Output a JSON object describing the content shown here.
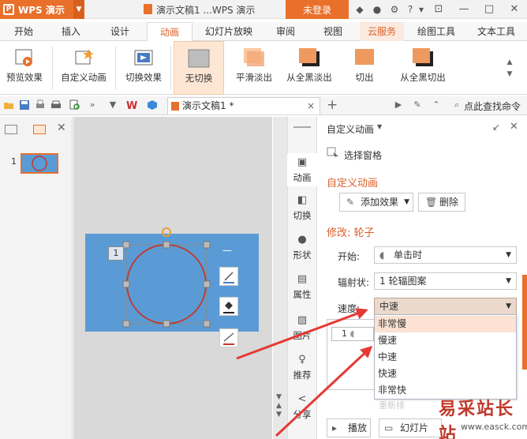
{
  "app": {
    "name": "WPS 演示",
    "logo_letter": "P"
  },
  "window": {
    "title": "演示文稿1 ...WPS 演示",
    "login": "未登录",
    "help": "?"
  },
  "tabs": [
    "开始",
    "插入",
    "设计",
    "动画",
    "幻灯片放映",
    "审阅",
    "视图",
    "云服务",
    "绘图工具",
    "文本工具"
  ],
  "active_tab": "动画",
  "ribbon": {
    "preview": "预览效果",
    "custom_anim": "自定义动画",
    "transition": "切换效果",
    "items": [
      "无切换",
      "平滑淡出",
      "从全黑淡出",
      "切出",
      "从全黑切出"
    ]
  },
  "qbar": {
    "doc_tab": "演示文稿1 *",
    "close": "×",
    "plus": "+",
    "search": "点此查找命令"
  },
  "slides": {
    "number": "1"
  },
  "canvas": {
    "anim_badge": "1"
  },
  "sidebar": [
    "动画",
    "切换",
    "形状",
    "属性",
    "图片",
    "推荐",
    "分享"
  ],
  "pane": {
    "title": "自定义动画",
    "select_pane": "选择窗格",
    "section": "自定义动画",
    "add_effect": "添加效果",
    "delete": "删除",
    "modify": "修改: 轮子",
    "start_label": "开始:",
    "start_value": "单击时",
    "spokes_label": "辐射状:",
    "spokes_value": "1 轮辐图案",
    "speed_label": "速度:",
    "speed_value": "中速",
    "list_item_num": "1",
    "reorder": "重新排",
    "play": "播放",
    "slideshow": "幻灯片"
  },
  "speed_options": [
    "非常慢",
    "慢速",
    "中速",
    "快速",
    "非常快"
  ],
  "watermark": {
    "text": "易采站长站",
    "url": "www.easck.com"
  },
  "colors": {
    "accent": "#e8702a",
    "slide_bg": "#5b9bd5",
    "circle": "#c0392b",
    "arrow": "#e53935"
  }
}
